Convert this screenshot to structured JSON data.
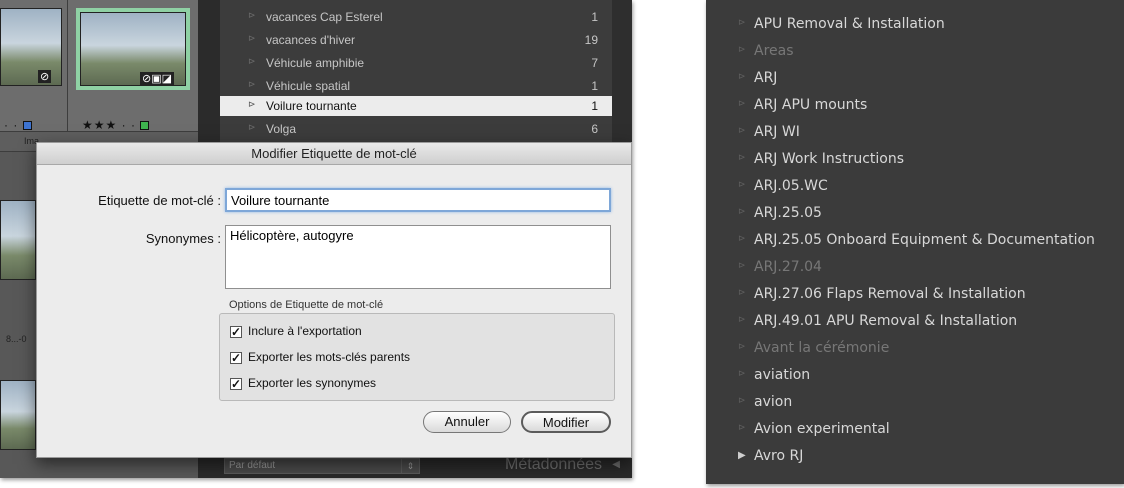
{
  "left": {
    "filmstrip": {
      "thumb2_stars": "★★★ · ·",
      "thumb1_stars": "· ·",
      "truncated_label": "Ima",
      "truncated_text": "8...-0"
    },
    "keyword_list": [
      {
        "name": "vacances Cap Esterel",
        "count": "1"
      },
      {
        "name": "vacances d'hiver",
        "count": "19"
      },
      {
        "name": "Véhicule amphibie",
        "count": "7"
      },
      {
        "name": "Véhicule spatial",
        "count": "1"
      },
      {
        "name": "Voilure tournante",
        "count": "1"
      },
      {
        "name": "Volga",
        "count": "6"
      }
    ],
    "metadata_bar": {
      "preset": "Par défaut",
      "title": "Métadonnées"
    },
    "dialog": {
      "title": "Modifier Etiquette de mot-clé",
      "keyword_label": "Etiquette de mot-clé :",
      "keyword_value": "Voilure tournante",
      "synonyms_label": "Synonymes :",
      "synonyms_value": "Hélicoptère, autogyre",
      "options_caption": "Options de Etiquette de mot-clé",
      "options": [
        "Inclure à l'exportation",
        "Exporter les mots-clés parents",
        "Exporter les synonymes"
      ],
      "cancel_label": "Annuler",
      "modify_label": "Modifier"
    }
  },
  "right": {
    "keyword_list": [
      {
        "name": "APU Removal & Installation",
        "dim": false
      },
      {
        "name": "Areas",
        "dim": true
      },
      {
        "name": "ARJ",
        "dim": false
      },
      {
        "name": "ARJ APU mounts",
        "dim": false
      },
      {
        "name": "ARJ WI",
        "dim": false
      },
      {
        "name": "ARJ Work Instructions",
        "dim": false
      },
      {
        "name": "ARJ.05.WC",
        "dim": false
      },
      {
        "name": "ARJ.25.05",
        "dim": false
      },
      {
        "name": "ARJ.25.05 Onboard Equipment & Documentation",
        "dim": false
      },
      {
        "name": "ARJ.27.04",
        "dim": true
      },
      {
        "name": "ARJ.27.06 Flaps Removal & Installation",
        "dim": false
      },
      {
        "name": "ARJ.49.01 APU Removal & Installation",
        "dim": false
      },
      {
        "name": "Avant la cérémonie",
        "dim": true
      },
      {
        "name": "aviation",
        "dim": false
      },
      {
        "name": "avion",
        "dim": false
      },
      {
        "name": "Avion experimental",
        "dim": false
      },
      {
        "name": "Avro RJ",
        "dim": false
      }
    ]
  },
  "icons": {
    "collapsed_arrow": "⊳",
    "expand_arrow": "▶",
    "dropdown": "⇕",
    "panel_collapse": "◀",
    "checkmark": "✓"
  }
}
